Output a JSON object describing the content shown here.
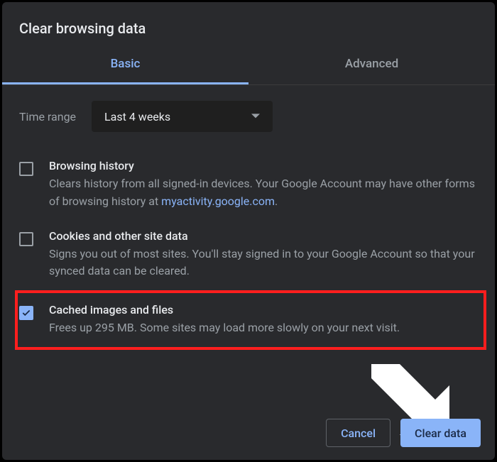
{
  "dialog": {
    "title": "Clear browsing data",
    "tabs": {
      "basic": "Basic",
      "advanced": "Advanced"
    },
    "timeRange": {
      "label": "Time range",
      "value": "Last 4 weeks"
    },
    "items": [
      {
        "checked": false,
        "title": "Browsing history",
        "desc_pre": "Clears history from all signed-in devices. Your Google Account may have other forms of browsing history at ",
        "link": "myaccount.google.com",
        "link_display": "myactivity.google.com",
        "desc_post": "."
      },
      {
        "checked": false,
        "title": "Cookies and other site data",
        "desc": "Signs you out of most sites. You'll stay signed in to your Google Account so that your synced data can be cleared."
      },
      {
        "checked": true,
        "title": "Cached images and files",
        "desc": "Frees up 295 MB. Some sites may load more slowly on your next visit."
      }
    ],
    "buttons": {
      "cancel": "Cancel",
      "clear": "Clear data"
    }
  }
}
